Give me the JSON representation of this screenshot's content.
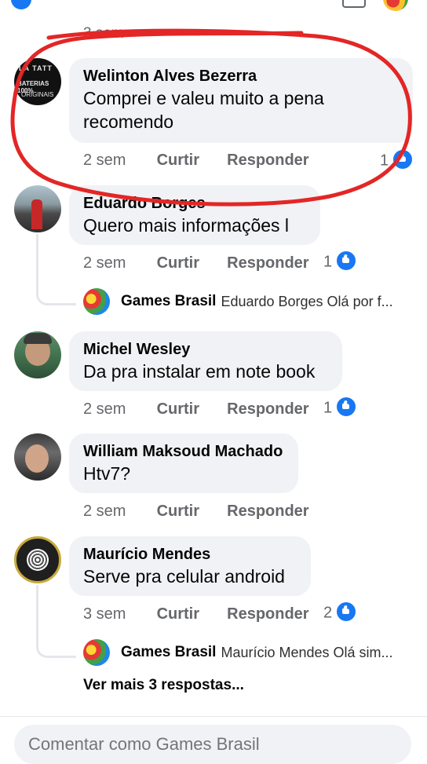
{
  "above_time": "3 sem",
  "actions": {
    "like": "Curtir",
    "reply": "Responder"
  },
  "comments": [
    {
      "author": "Welinton Alves Bezerra",
      "lines": [
        "Comprei e valeu muito a pena",
        "recomendo"
      ],
      "time": "2 sem",
      "reactions": "1",
      "avatar_text": [
        "LA TATT",
        "BATERIAS 100%",
        "ORIGINAIS"
      ]
    },
    {
      "author": "Eduardo Borges",
      "lines": [
        "Quero mais informações l"
      ],
      "time": "2 sem",
      "reactions": "1"
    },
    {
      "author": "Michel Wesley",
      "lines": [
        "Da pra instalar em note book"
      ],
      "time": "2 sem",
      "reactions": "1"
    },
    {
      "author": "William Maksoud Machado",
      "lines": [
        "Htv7?"
      ],
      "time": "2 sem",
      "reactions": ""
    },
    {
      "author": "Maurício Mendes",
      "lines": [
        "Serve pra celular android"
      ],
      "time": "3 sem",
      "reactions": "2"
    }
  ],
  "replies": [
    {
      "author": "Games Brasil",
      "text": "Eduardo Borges Olá por f..."
    },
    {
      "author": "Games Brasil",
      "text": "Maurício Mendes Olá sim..."
    }
  ],
  "more_replies": "Ver mais 3 respostas...",
  "composer": {
    "placeholder": "Comentar como Games Brasil"
  },
  "colors": {
    "accent": "#1877f2",
    "annotation": "#e32626",
    "bubble": "#f0f2f5"
  }
}
